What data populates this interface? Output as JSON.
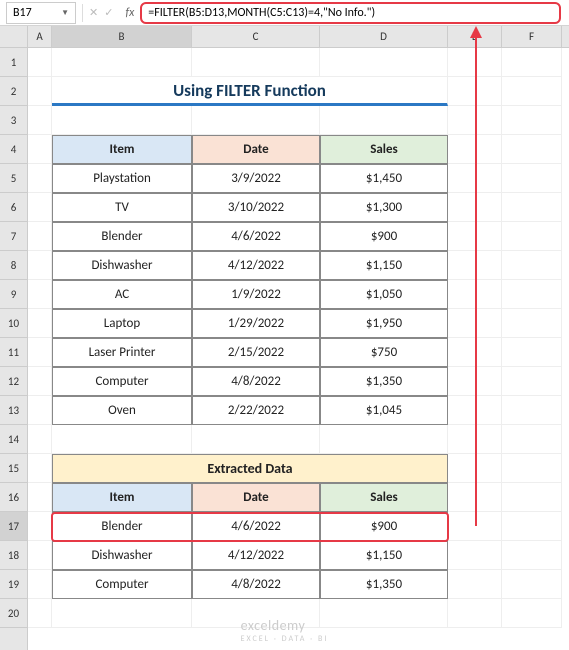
{
  "nameBox": "B17",
  "formula": "=FILTER(B5:D13,MONTH(C5:C13)=4,\"No Info.\")",
  "fxLabel": "fx",
  "title": "Using FILTER Function",
  "headers": {
    "item": "Item",
    "date": "Date",
    "sales": "Sales"
  },
  "table1": [
    {
      "item": "Playstation",
      "date": "3/9/2022",
      "sales": "$1,450"
    },
    {
      "item": "TV",
      "date": "3/10/2022",
      "sales": "$1,300"
    },
    {
      "item": "Blender",
      "date": "4/6/2022",
      "sales": "$900"
    },
    {
      "item": "Dishwasher",
      "date": "4/12/2022",
      "sales": "$1,150"
    },
    {
      "item": "AC",
      "date": "1/9/2022",
      "sales": "$1,050"
    },
    {
      "item": "Laptop",
      "date": "1/29/2022",
      "sales": "$1,950"
    },
    {
      "item": "Laser Printer",
      "date": "2/15/2022",
      "sales": "$750"
    },
    {
      "item": "Computer",
      "date": "4/8/2022",
      "sales": "$1,350"
    },
    {
      "item": "Oven",
      "date": "2/22/2022",
      "sales": "$1,045"
    }
  ],
  "extractedTitle": "Extracted Data",
  "table2": [
    {
      "item": "Blender",
      "date": "4/6/2022",
      "sales": "$900"
    },
    {
      "item": "Dishwasher",
      "date": "4/12/2022",
      "sales": "$1,150"
    },
    {
      "item": "Computer",
      "date": "4/8/2022",
      "sales": "$1,350"
    }
  ],
  "columns": [
    "A",
    "B",
    "C",
    "D",
    "E",
    "F"
  ],
  "rows": [
    "1",
    "2",
    "3",
    "4",
    "5",
    "6",
    "7",
    "8",
    "9",
    "10",
    "11",
    "12",
    "13",
    "14",
    "15",
    "16",
    "17",
    "18",
    "19",
    "20"
  ],
  "watermark": {
    "main": "exceldemy",
    "sub": "EXCEL · DATA · BI"
  }
}
